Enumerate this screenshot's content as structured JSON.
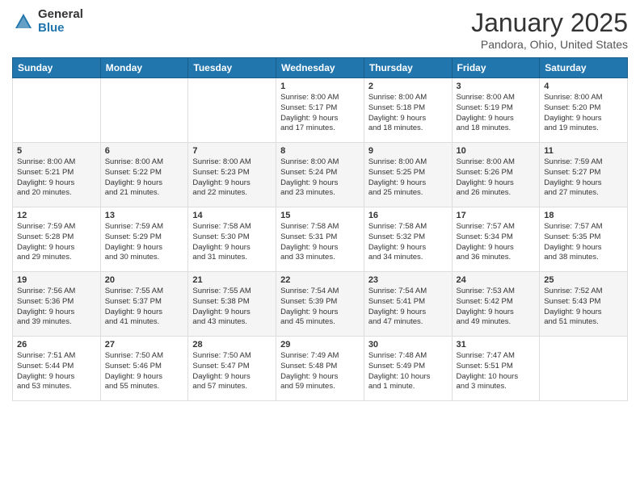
{
  "header": {
    "logo_general": "General",
    "logo_blue": "Blue",
    "title": "January 2025",
    "location": "Pandora, Ohio, United States"
  },
  "days": [
    "Sunday",
    "Monday",
    "Tuesday",
    "Wednesday",
    "Thursday",
    "Friday",
    "Saturday"
  ],
  "rows": [
    [
      {
        "date": "",
        "info": ""
      },
      {
        "date": "",
        "info": ""
      },
      {
        "date": "",
        "info": ""
      },
      {
        "date": "1",
        "info": "Sunrise: 8:00 AM\nSunset: 5:17 PM\nDaylight: 9 hours\nand 17 minutes."
      },
      {
        "date": "2",
        "info": "Sunrise: 8:00 AM\nSunset: 5:18 PM\nDaylight: 9 hours\nand 18 minutes."
      },
      {
        "date": "3",
        "info": "Sunrise: 8:00 AM\nSunset: 5:19 PM\nDaylight: 9 hours\nand 18 minutes."
      },
      {
        "date": "4",
        "info": "Sunrise: 8:00 AM\nSunset: 5:20 PM\nDaylight: 9 hours\nand 19 minutes."
      }
    ],
    [
      {
        "date": "5",
        "info": "Sunrise: 8:00 AM\nSunset: 5:21 PM\nDaylight: 9 hours\nand 20 minutes."
      },
      {
        "date": "6",
        "info": "Sunrise: 8:00 AM\nSunset: 5:22 PM\nDaylight: 9 hours\nand 21 minutes."
      },
      {
        "date": "7",
        "info": "Sunrise: 8:00 AM\nSunset: 5:23 PM\nDaylight: 9 hours\nand 22 minutes."
      },
      {
        "date": "8",
        "info": "Sunrise: 8:00 AM\nSunset: 5:24 PM\nDaylight: 9 hours\nand 23 minutes."
      },
      {
        "date": "9",
        "info": "Sunrise: 8:00 AM\nSunset: 5:25 PM\nDaylight: 9 hours\nand 25 minutes."
      },
      {
        "date": "10",
        "info": "Sunrise: 8:00 AM\nSunset: 5:26 PM\nDaylight: 9 hours\nand 26 minutes."
      },
      {
        "date": "11",
        "info": "Sunrise: 7:59 AM\nSunset: 5:27 PM\nDaylight: 9 hours\nand 27 minutes."
      }
    ],
    [
      {
        "date": "12",
        "info": "Sunrise: 7:59 AM\nSunset: 5:28 PM\nDaylight: 9 hours\nand 29 minutes."
      },
      {
        "date": "13",
        "info": "Sunrise: 7:59 AM\nSunset: 5:29 PM\nDaylight: 9 hours\nand 30 minutes."
      },
      {
        "date": "14",
        "info": "Sunrise: 7:58 AM\nSunset: 5:30 PM\nDaylight: 9 hours\nand 31 minutes."
      },
      {
        "date": "15",
        "info": "Sunrise: 7:58 AM\nSunset: 5:31 PM\nDaylight: 9 hours\nand 33 minutes."
      },
      {
        "date": "16",
        "info": "Sunrise: 7:58 AM\nSunset: 5:32 PM\nDaylight: 9 hours\nand 34 minutes."
      },
      {
        "date": "17",
        "info": "Sunrise: 7:57 AM\nSunset: 5:34 PM\nDaylight: 9 hours\nand 36 minutes."
      },
      {
        "date": "18",
        "info": "Sunrise: 7:57 AM\nSunset: 5:35 PM\nDaylight: 9 hours\nand 38 minutes."
      }
    ],
    [
      {
        "date": "19",
        "info": "Sunrise: 7:56 AM\nSunset: 5:36 PM\nDaylight: 9 hours\nand 39 minutes."
      },
      {
        "date": "20",
        "info": "Sunrise: 7:55 AM\nSunset: 5:37 PM\nDaylight: 9 hours\nand 41 minutes."
      },
      {
        "date": "21",
        "info": "Sunrise: 7:55 AM\nSunset: 5:38 PM\nDaylight: 9 hours\nand 43 minutes."
      },
      {
        "date": "22",
        "info": "Sunrise: 7:54 AM\nSunset: 5:39 PM\nDaylight: 9 hours\nand 45 minutes."
      },
      {
        "date": "23",
        "info": "Sunrise: 7:54 AM\nSunset: 5:41 PM\nDaylight: 9 hours\nand 47 minutes."
      },
      {
        "date": "24",
        "info": "Sunrise: 7:53 AM\nSunset: 5:42 PM\nDaylight: 9 hours\nand 49 minutes."
      },
      {
        "date": "25",
        "info": "Sunrise: 7:52 AM\nSunset: 5:43 PM\nDaylight: 9 hours\nand 51 minutes."
      }
    ],
    [
      {
        "date": "26",
        "info": "Sunrise: 7:51 AM\nSunset: 5:44 PM\nDaylight: 9 hours\nand 53 minutes."
      },
      {
        "date": "27",
        "info": "Sunrise: 7:50 AM\nSunset: 5:46 PM\nDaylight: 9 hours\nand 55 minutes."
      },
      {
        "date": "28",
        "info": "Sunrise: 7:50 AM\nSunset: 5:47 PM\nDaylight: 9 hours\nand 57 minutes."
      },
      {
        "date": "29",
        "info": "Sunrise: 7:49 AM\nSunset: 5:48 PM\nDaylight: 9 hours\nand 59 minutes."
      },
      {
        "date": "30",
        "info": "Sunrise: 7:48 AM\nSunset: 5:49 PM\nDaylight: 10 hours\nand 1 minute."
      },
      {
        "date": "31",
        "info": "Sunrise: 7:47 AM\nSunset: 5:51 PM\nDaylight: 10 hours\nand 3 minutes."
      },
      {
        "date": "",
        "info": ""
      }
    ]
  ]
}
